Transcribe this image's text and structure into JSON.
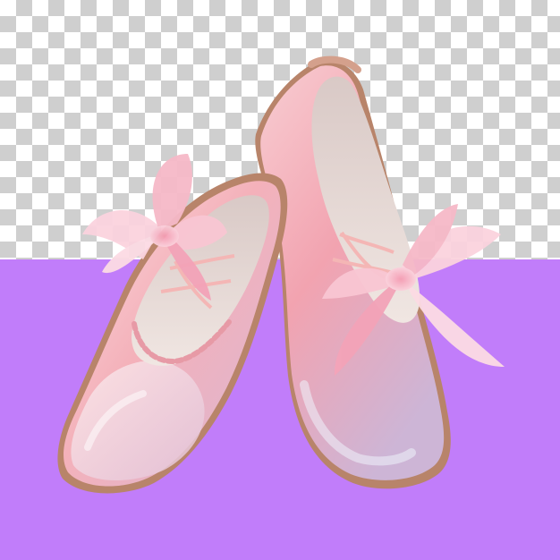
{
  "scene": {
    "subject": "pink-ballet-flats-pair",
    "background": {
      "pattern": "transparency-checkerboard",
      "panel_color": "#c17dfa",
      "checker_light": "#ffffff",
      "checker_dark": "#cfcfcf"
    },
    "colors": {
      "satin_light": "#f9d2d6",
      "satin_mid": "#f2a7b1",
      "satin_shadow": "#c9a4c8",
      "lining": "#e7ddd9",
      "sole": "#b8846a",
      "bow_light": "#fbd3de",
      "bow_mid": "#f3a3b8",
      "ribbon": "#f4b6b5"
    }
  }
}
